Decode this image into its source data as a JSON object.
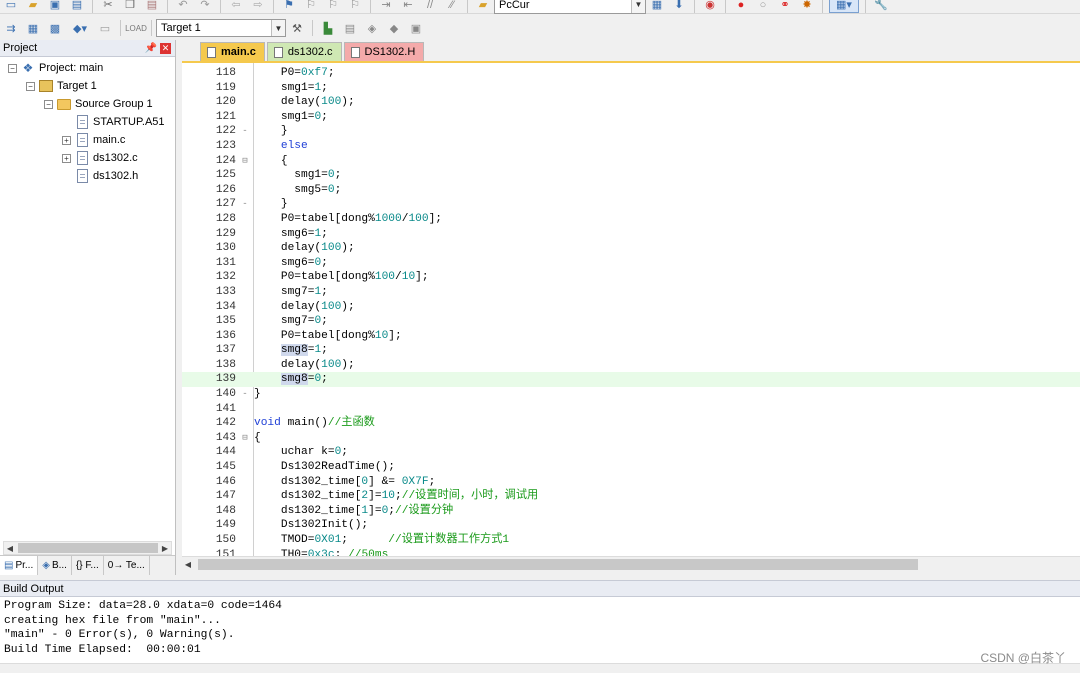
{
  "toolbar1": {
    "combo_value": "PcCur"
  },
  "toolbar2": {
    "target_value": "Target 1"
  },
  "project_panel": {
    "title": "Project",
    "tree": [
      {
        "label": "Project: main",
        "icon": "project-icon",
        "expander": "minus"
      },
      {
        "label": "Target 1",
        "icon": "target-icon",
        "expander": "minus"
      },
      {
        "label": "Source Group 1",
        "icon": "folder-icon",
        "expander": "minus"
      },
      {
        "label": "STARTUP.A51",
        "icon": "file-icon",
        "expander": ""
      },
      {
        "label": "main.c",
        "icon": "file-icon",
        "expander": "plus"
      },
      {
        "label": "ds1302.c",
        "icon": "file-icon",
        "expander": "plus"
      },
      {
        "label": "ds1302.h",
        "icon": "file-icon",
        "expander": ""
      }
    ],
    "bottom_tabs": [
      {
        "label": "Pr...",
        "icon": "project-tab-icon"
      },
      {
        "label": "B...",
        "icon": "books-tab-icon"
      },
      {
        "label": "{} F...",
        "icon": "functions-tab-icon"
      },
      {
        "label": "0→ Te...",
        "icon": "templates-tab-icon"
      }
    ]
  },
  "file_tabs": [
    {
      "label": "main.c",
      "active": true
    },
    {
      "label": "ds1302.c",
      "active": false
    },
    {
      "label": "DS1302.H",
      "active": false
    }
  ],
  "code_lines": [
    {
      "n": "118",
      "fold": "",
      "tokens": [
        [
          "",
          "    P0="
        ],
        [
          "num",
          "0xf7"
        ],
        [
          "",
          ";"
        ]
      ]
    },
    {
      "n": "119",
      "fold": "",
      "tokens": [
        [
          "",
          "    smg1="
        ],
        [
          "num",
          "1"
        ],
        [
          "",
          ";"
        ]
      ]
    },
    {
      "n": "120",
      "fold": "",
      "tokens": [
        [
          "",
          "    delay("
        ],
        [
          "num",
          "100"
        ],
        [
          "",
          ");"
        ]
      ]
    },
    {
      "n": "121",
      "fold": "",
      "tokens": [
        [
          "",
          "    smg1="
        ],
        [
          "num",
          "0"
        ],
        [
          "",
          ";"
        ]
      ]
    },
    {
      "n": "122",
      "fold": "-",
      "tokens": [
        [
          "",
          "    }"
        ]
      ]
    },
    {
      "n": "123",
      "fold": "",
      "tokens": [
        [
          "",
          "    "
        ],
        [
          "kw",
          "else"
        ]
      ]
    },
    {
      "n": "124",
      "fold": "⊟",
      "tokens": [
        [
          "",
          "    {"
        ]
      ]
    },
    {
      "n": "125",
      "fold": "",
      "tokens": [
        [
          "",
          "      smg1="
        ],
        [
          "num",
          "0"
        ],
        [
          "",
          ";"
        ]
      ]
    },
    {
      "n": "126",
      "fold": "",
      "tokens": [
        [
          "",
          "      smg5="
        ],
        [
          "num",
          "0"
        ],
        [
          "",
          ";"
        ]
      ]
    },
    {
      "n": "127",
      "fold": "-",
      "tokens": [
        [
          "",
          "    }"
        ]
      ]
    },
    {
      "n": "128",
      "fold": "",
      "tokens": [
        [
          "",
          "    P0=tabel[dong%"
        ],
        [
          "num",
          "1000"
        ],
        [
          "",
          "/"
        ],
        [
          "num",
          "100"
        ],
        [
          "",
          "];"
        ]
      ]
    },
    {
      "n": "129",
      "fold": "",
      "tokens": [
        [
          "",
          "    smg6="
        ],
        [
          "num",
          "1"
        ],
        [
          "",
          ";"
        ]
      ]
    },
    {
      "n": "130",
      "fold": "",
      "tokens": [
        [
          "",
          "    delay("
        ],
        [
          "num",
          "100"
        ],
        [
          "",
          ");"
        ]
      ]
    },
    {
      "n": "131",
      "fold": "",
      "tokens": [
        [
          "",
          "    smg6="
        ],
        [
          "num",
          "0"
        ],
        [
          "",
          ";"
        ]
      ]
    },
    {
      "n": "132",
      "fold": "",
      "tokens": [
        [
          "",
          "    P0=tabel[dong%"
        ],
        [
          "num",
          "100"
        ],
        [
          "",
          "/"
        ],
        [
          "num",
          "10"
        ],
        [
          "",
          "];"
        ]
      ]
    },
    {
      "n": "133",
      "fold": "",
      "tokens": [
        [
          "",
          "    smg7="
        ],
        [
          "num",
          "1"
        ],
        [
          "",
          ";"
        ]
      ]
    },
    {
      "n": "134",
      "fold": "",
      "tokens": [
        [
          "",
          "    delay("
        ],
        [
          "num",
          "100"
        ],
        [
          "",
          ");"
        ]
      ]
    },
    {
      "n": "135",
      "fold": "",
      "tokens": [
        [
          "",
          "    smg7="
        ],
        [
          "num",
          "0"
        ],
        [
          "",
          ";"
        ]
      ]
    },
    {
      "n": "136",
      "fold": "",
      "tokens": [
        [
          "",
          "    P0=tabel[dong%"
        ],
        [
          "num",
          "10"
        ],
        [
          "",
          "];"
        ]
      ]
    },
    {
      "n": "137",
      "fold": "",
      "tokens": [
        [
          "",
          "    "
        ],
        [
          "sel",
          "smg8"
        ],
        [
          "",
          "="
        ],
        [
          "num",
          "1"
        ],
        [
          "",
          ";"
        ]
      ]
    },
    {
      "n": "138",
      "fold": "",
      "tokens": [
        [
          "",
          "    delay("
        ],
        [
          "num",
          "100"
        ],
        [
          "",
          ");"
        ]
      ]
    },
    {
      "n": "139",
      "fold": "",
      "hl": true,
      "tokens": [
        [
          "",
          "    "
        ],
        [
          "sel",
          "smg8"
        ],
        [
          "",
          "="
        ],
        [
          "num",
          "0"
        ],
        [
          "",
          ";"
        ]
      ]
    },
    {
      "n": "140",
      "fold": "-",
      "tokens": [
        [
          "",
          "}"
        ]
      ]
    },
    {
      "n": "141",
      "fold": "",
      "tokens": [
        [
          "",
          ""
        ]
      ]
    },
    {
      "n": "142",
      "fold": "",
      "tokens": [
        [
          "kw",
          "void"
        ],
        [
          "",
          " main()"
        ],
        [
          "cm",
          "//主函数"
        ]
      ]
    },
    {
      "n": "143",
      "fold": "⊟",
      "tokens": [
        [
          "",
          "{"
        ]
      ]
    },
    {
      "n": "144",
      "fold": "",
      "tokens": [
        [
          "",
          "    uchar k="
        ],
        [
          "num",
          "0"
        ],
        [
          "",
          ";"
        ]
      ]
    },
    {
      "n": "145",
      "fold": "",
      "tokens": [
        [
          "",
          "    Ds1302ReadTime();"
        ]
      ]
    },
    {
      "n": "146",
      "fold": "",
      "tokens": [
        [
          "",
          "    ds1302_time["
        ],
        [
          "num",
          "0"
        ],
        [
          "",
          "] &= "
        ],
        [
          "num",
          "0X7F"
        ],
        [
          "",
          ";"
        ]
      ]
    },
    {
      "n": "147",
      "fold": "",
      "tokens": [
        [
          "",
          "    ds1302_time["
        ],
        [
          "num",
          "2"
        ],
        [
          "",
          "]="
        ],
        [
          "num",
          "10"
        ],
        [
          "",
          ";"
        ],
        [
          "cm",
          "//设置时间，小时，调试用"
        ]
      ]
    },
    {
      "n": "148",
      "fold": "",
      "tokens": [
        [
          "",
          "    ds1302_time["
        ],
        [
          "num",
          "1"
        ],
        [
          "",
          "]="
        ],
        [
          "num",
          "0"
        ],
        [
          "",
          ";"
        ],
        [
          "cm",
          "//设置分钟"
        ]
      ]
    },
    {
      "n": "149",
      "fold": "",
      "tokens": [
        [
          "",
          "    Ds1302Init();"
        ]
      ]
    },
    {
      "n": "150",
      "fold": "",
      "tokens": [
        [
          "",
          "    TMOD="
        ],
        [
          "num",
          "0X01"
        ],
        [
          "",
          ";      "
        ],
        [
          "cm",
          "//设置计数器工作方式1"
        ]
      ]
    },
    {
      "n": "151",
      "fold": "",
      "tokens": [
        [
          "",
          "    TH0="
        ],
        [
          "num",
          "0x3c"
        ],
        [
          "",
          "; "
        ],
        [
          "cm",
          "//50ms"
        ]
      ]
    }
  ],
  "build_output": {
    "title": "Build Output",
    "lines": [
      "Program Size: data=28.0 xdata=0 code=1464",
      "creating hex file from \"main\"...",
      "\"main\" - 0 Error(s), 0 Warning(s).",
      "Build Time Elapsed:  00:00:01"
    ]
  },
  "watermark": "CSDN @白茶丫"
}
